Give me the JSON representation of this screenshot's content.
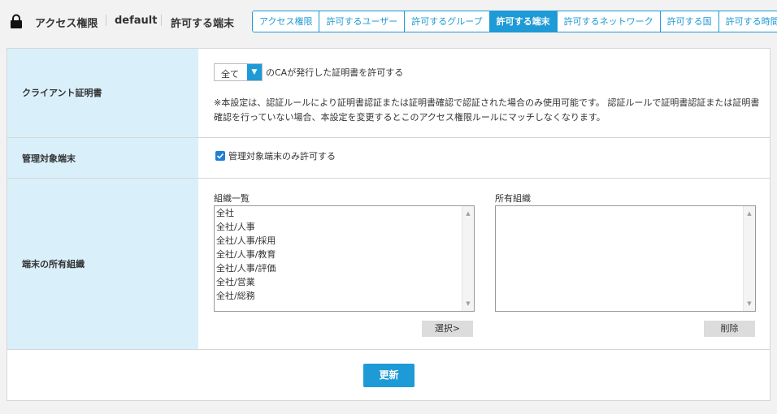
{
  "header": {
    "crumbs": [
      "アクセス権限",
      "default",
      "許可する端末"
    ]
  },
  "tabs": [
    {
      "label": "アクセス権限",
      "active": false
    },
    {
      "label": "許可するユーザー",
      "active": false
    },
    {
      "label": "許可するグループ",
      "active": false
    },
    {
      "label": "許可する端末",
      "active": true
    },
    {
      "label": "許可するネットワーク",
      "active": false
    },
    {
      "label": "許可する国",
      "active": false
    },
    {
      "label": "許可する時間",
      "active": false
    }
  ],
  "client_cert": {
    "label": "クライアント証明書",
    "select_value": "全て",
    "after_select": "のCAが発行した証明書を許可する",
    "note": "※本設定は、認証ルールにより証明書認証または証明書確認で認証された場合のみ使用可能です。 認証ルールで証明書認証または証明書確認を行っていない場合、本設定を変更するとこのアクセス権限ルールにマッチしなくなります。"
  },
  "managed": {
    "label": "管理対象端末",
    "checkbox_label": "管理対象端末のみ許可する",
    "checked": true
  },
  "org": {
    "label": "端末の所有組織",
    "left_title": "組織一覧",
    "right_title": "所有組織",
    "items": [
      "全社",
      "全社/人事",
      "全社/人事/採用",
      "全社/人事/教育",
      "全社/人事/評価",
      "全社/営業",
      "全社/総務"
    ],
    "select_button": "選択>",
    "delete_button": "削除"
  },
  "update_button": "更新",
  "colors": {
    "accent": "#1e9ad6",
    "label_bg": "#d9f0fb"
  }
}
